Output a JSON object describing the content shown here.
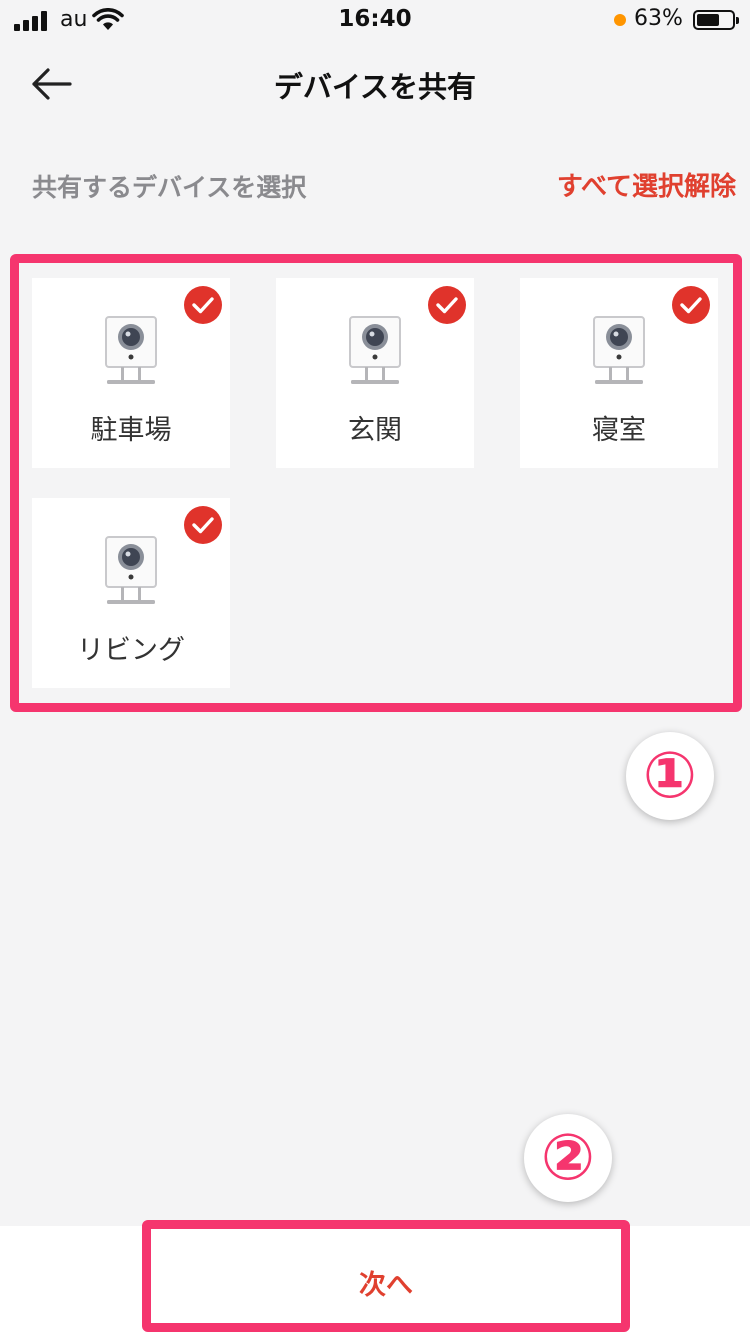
{
  "status_bar": {
    "carrier": "au",
    "time": "16:40",
    "battery_percent": "63%"
  },
  "header": {
    "title": "デバイスを共有",
    "back_icon": "arrow-left-icon"
  },
  "selection": {
    "label": "共有するデバイスを選択",
    "deselect_all": "すべて選択解除"
  },
  "devices": [
    {
      "name": "駐車場",
      "selected": true
    },
    {
      "name": "玄関",
      "selected": true
    },
    {
      "name": "寝室",
      "selected": true
    },
    {
      "name": "リビング",
      "selected": true
    }
  ],
  "annotations": {
    "marker_1": "①",
    "marker_2": "②"
  },
  "footer": {
    "next_label": "次へ"
  },
  "colors": {
    "accent": "#e0402f",
    "highlight": "#f5356e",
    "background": "#f4f4f5"
  }
}
